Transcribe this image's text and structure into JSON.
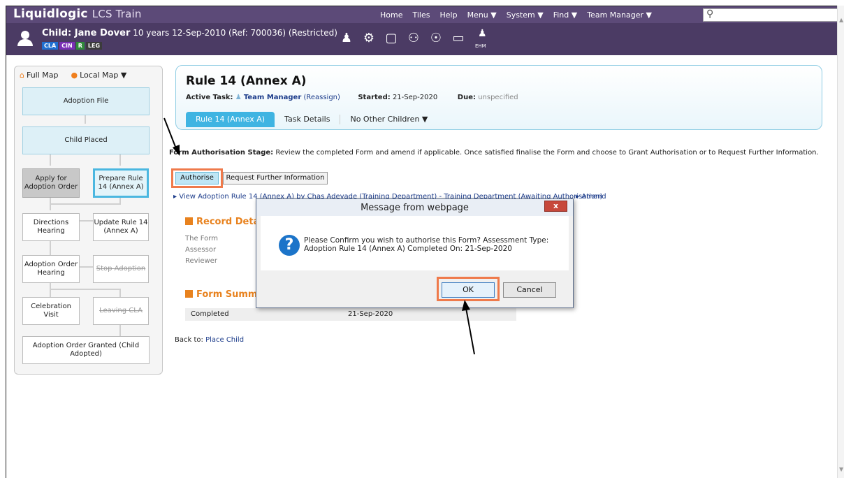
{
  "app": {
    "logo": "Liquidlogic",
    "product": "LCS Train"
  },
  "topnav": [
    "Home",
    "Tiles",
    "Help",
    "Menu ▼",
    "System ▼",
    "Find ▼",
    "Team Manager ▼"
  ],
  "search": {
    "placeholder": ""
  },
  "child": {
    "name": "Child: Jane Dover",
    "details": "10 years 12-Sep-2010 (Ref: 700036) (Restricted)",
    "flags": [
      {
        "label": "CLA",
        "color": "#1f6fd1"
      },
      {
        "label": "CIN",
        "color": "#7a2fb5"
      },
      {
        "label": "R",
        "color": "#2f8a3a"
      },
      {
        "label": "LEG",
        "color": "#3b3b3b"
      }
    ],
    "icons": [
      "person-icon",
      "gear-icon",
      "document-icon",
      "group-icon",
      "contact-icon",
      "chat-icon",
      "ehm-icon"
    ],
    "ehm_label": "EHM"
  },
  "sidebar": {
    "full_map": "Full Map",
    "local_map": "Local Map ▼",
    "nodes": {
      "adoption_file": "Adoption File",
      "child_placed": "Child Placed",
      "apply_order": "Apply for Adoption Order",
      "prepare_rule": "Prepare Rule 14 (Annex A)",
      "directions": "Directions Hearing",
      "update_rule": "Update Rule 14 (Annex A)",
      "order_hearing": "Adoption Order Hearing",
      "stop_adoption": "Stop Adoption",
      "celebration": "Celebration Visit",
      "leaving_cla": "Leaving CLA",
      "order_granted": "Adoption Order Granted (Child Adopted)"
    }
  },
  "header": {
    "title": "Rule 14 (Annex A)",
    "active_task_label": "Active Task:",
    "active_task_value": "Team Manager",
    "reassign": "(Reassign)",
    "started_label": "Started:",
    "started_value": "21-Sep-2020",
    "due_label": "Due:",
    "due_value": "unspecified",
    "tabs": [
      "Rule 14 (Annex A)",
      "Task Details",
      "No Other Children ▼"
    ]
  },
  "stage": {
    "label": "Form Authorisation Stage:",
    "text": "Review the completed Form and amend if applicable. Once satisfied finalise the Form and choose to Grant Authorisation or to Request Further Information."
  },
  "buttons": {
    "authorise": "Authorise",
    "request_info": "Request Further Information"
  },
  "view_link": "View Adoption Rule 14 (Annex A) by Chas Adeyade (Training Department) - Training Department (Awaiting Authorisation)",
  "amend_link": "Amend",
  "record": {
    "title": "Record Detail",
    "fields": [
      "The Form",
      "Assessor",
      "Reviewer"
    ]
  },
  "summary": {
    "title": "Form Summa",
    "row_label": "Completed",
    "row_value": "21-Sep-2020"
  },
  "back": {
    "label": "Back to:",
    "link": "Place Child"
  },
  "dialog": {
    "title": "Message from webpage",
    "close": "x",
    "line1": "Please Confirm you wish to authorise this Form?  Assessment Type:",
    "line2": "Adoption Rule 14 (Annex A) Completed On:      21-Sep-2020",
    "ok": "OK",
    "cancel": "Cancel"
  },
  "colors": {
    "topbar": "#5c4a78",
    "accent": "#3fb4e2",
    "highlight": "#ef7a4b",
    "section": "#e8821e"
  }
}
